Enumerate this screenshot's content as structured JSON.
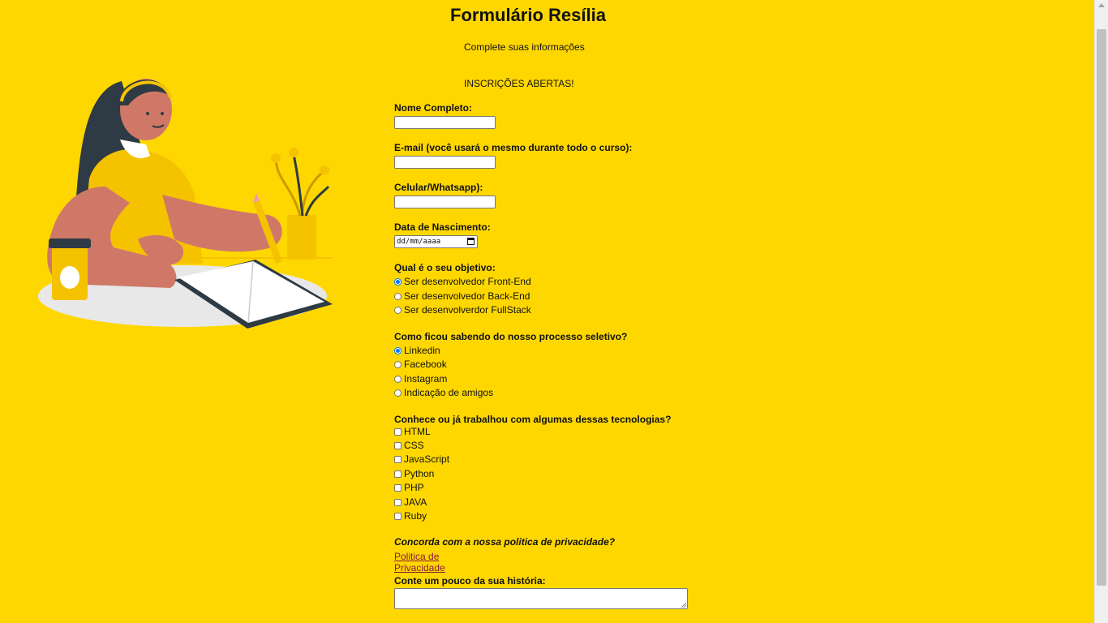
{
  "header": {
    "title": "Formulário Resília",
    "subtitle": "Complete suas informações",
    "open_notice": "INSCRIÇÕES ABERTAS!"
  },
  "form": {
    "name_label": "Nome Completo:",
    "email_label": "E-mail (você usará o mesmo durante todo o curso):",
    "phone_label": "Celular/Whatsapp):",
    "birth_label": "Data de Nascimento:",
    "birth_placeholder": "dd/mm/aaaa",
    "objective": {
      "label": "Qual é o seu objetivo:",
      "options": [
        "Ser desenvolvedor Front-End",
        "Ser desenvolvedor Back-End",
        "Ser desenvolverdor FullStack"
      ],
      "selected": "Ser desenvolvedor Front-End"
    },
    "source": {
      "label": "Como ficou sabendo do nosso processo seletivo?",
      "options": [
        "Linkedin",
        "Facebook",
        "Instagram",
        "Indicação de amigos"
      ],
      "selected": "Linkedin"
    },
    "tech": {
      "label": "Conhece ou já trabalhou com algumas dessas tecnologias?",
      "options": [
        "HTML",
        "CSS",
        "JavaScript",
        "Python",
        "PHP",
        "JAVA",
        "Ruby"
      ]
    },
    "privacy_question": "Concorda com a nossa politica de privacidade?",
    "privacy_link": "Politica de Privacidade",
    "story_label": "Conte um pouco da sua história:"
  },
  "colors": {
    "background": "#FFD700",
    "radio_accent": "#0075ff",
    "link": "#8b1a3b"
  },
  "illustration": {
    "icon": "woman-writing-illustration"
  }
}
